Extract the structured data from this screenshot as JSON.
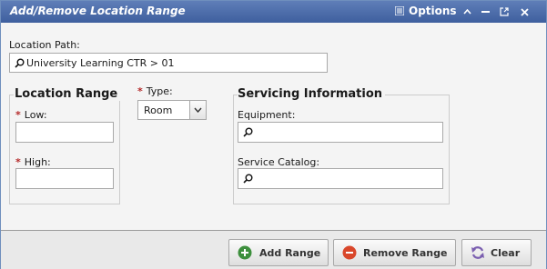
{
  "window": {
    "title": "Add/Remove Location Range",
    "options_label": "Options",
    "controls": [
      "collapse-icon",
      "minimize-icon",
      "popout-icon",
      "close-icon"
    ]
  },
  "location_path": {
    "label": "Location Path:",
    "value": "University Learning CTR > 01"
  },
  "location_range": {
    "title": "Location Range",
    "low_label": "Low:",
    "low_value": "",
    "high_label": "High:",
    "high_value": ""
  },
  "type": {
    "label": "Type:",
    "selected": "Room"
  },
  "servicing": {
    "title": "Servicing Information",
    "equipment_label": "Equipment:",
    "equipment_value": "",
    "catalog_label": "Service Catalog:",
    "catalog_value": ""
  },
  "buttons": {
    "add_range": "Add Range",
    "remove_range": "Remove Range",
    "clear": "Clear"
  },
  "colors": {
    "titlebar": "#4a6aa8",
    "required": "#b52a2a",
    "add": "#3d8f3d",
    "remove": "#d9472b",
    "clear": "#7b5fb0"
  }
}
